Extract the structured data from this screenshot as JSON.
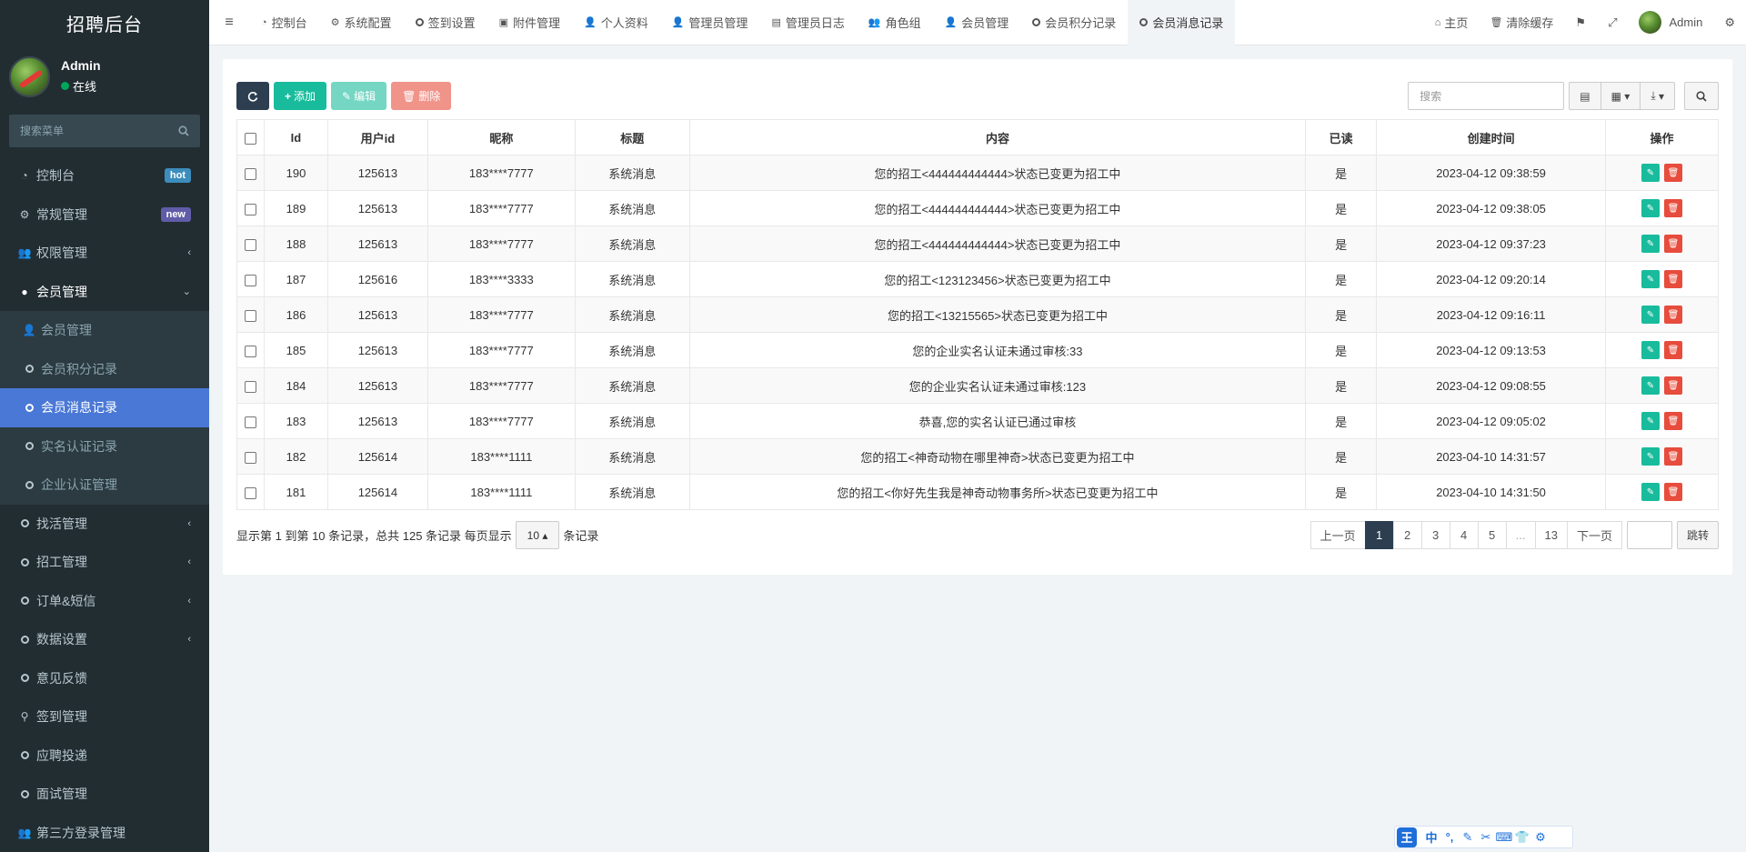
{
  "app": {
    "title": "招聘后台"
  },
  "user": {
    "name": "Admin",
    "status": "在线"
  },
  "sidebar": {
    "search_placeholder": "搜索菜单",
    "items": [
      {
        "label": "控制台",
        "badge": "hot",
        "icon": "dashboard-icon"
      },
      {
        "label": "常规管理",
        "badge": "new",
        "icon": "cogs-icon"
      },
      {
        "label": "权限管理",
        "icon": "group-icon"
      },
      {
        "label": "会员管理",
        "icon": "user-circle-icon"
      }
    ],
    "submenu": [
      {
        "label": "会员管理",
        "icon": "user-icon"
      },
      {
        "label": "会员积分记录",
        "icon": "circle-icon"
      },
      {
        "label": "会员消息记录",
        "icon": "circle-icon",
        "active": true
      },
      {
        "label": "实名认证记录",
        "icon": "circle-icon"
      },
      {
        "label": "企业认证管理",
        "icon": "circle-icon"
      }
    ],
    "items_after": [
      {
        "label": "找活管理",
        "icon": "circle-icon",
        "chevron": true
      },
      {
        "label": "招工管理",
        "icon": "circle-icon",
        "chevron": true
      },
      {
        "label": "订单&短信",
        "icon": "circle-icon",
        "chevron": true
      },
      {
        "label": "数据设置",
        "icon": "circle-icon",
        "chevron": true
      },
      {
        "label": "意见反馈",
        "icon": "circle-icon"
      },
      {
        "label": "签到管理",
        "icon": "map-marker-icon"
      },
      {
        "label": "应聘投递",
        "icon": "circle-icon"
      },
      {
        "label": "面试管理",
        "icon": "circle-icon"
      },
      {
        "label": "第三方登录管理",
        "icon": "users-icon"
      }
    ]
  },
  "topnav": {
    "tabs": [
      {
        "label": "控制台",
        "icon": "dashboard-icon"
      },
      {
        "label": "系统配置",
        "icon": "cog-icon"
      },
      {
        "label": "签到设置",
        "icon": "circle-icon"
      },
      {
        "label": "附件管理",
        "icon": "file-image-icon"
      },
      {
        "label": "个人资料",
        "icon": "user-icon"
      },
      {
        "label": "管理员管理",
        "icon": "user-icon"
      },
      {
        "label": "管理员日志",
        "icon": "list-alt-icon"
      },
      {
        "label": "角色组",
        "icon": "group-icon"
      },
      {
        "label": "会员管理",
        "icon": "user-icon"
      },
      {
        "label": "会员积分记录",
        "icon": "circle-icon"
      },
      {
        "label": "会员消息记录",
        "icon": "circle-icon",
        "active": true
      }
    ],
    "right": {
      "home": "主页",
      "clear_cache": "清除缓存",
      "admin": "Admin"
    }
  },
  "toolbar": {
    "add": "添加",
    "edit": "编辑",
    "delete": "删除",
    "search_placeholder": "搜索"
  },
  "table": {
    "headers": [
      "Id",
      "用户id",
      "昵称",
      "标题",
      "内容",
      "已读",
      "创建时间",
      "操作"
    ],
    "rows": [
      {
        "id": "190",
        "uid": "125613",
        "nick": "183****7777",
        "title": "系统消息",
        "content": "您的招工<444444444444>状态已变更为招工中",
        "read": "是",
        "time": "2023-04-12 09:38:59"
      },
      {
        "id": "189",
        "uid": "125613",
        "nick": "183****7777",
        "title": "系统消息",
        "content": "您的招工<444444444444>状态已变更为招工中",
        "read": "是",
        "time": "2023-04-12 09:38:05"
      },
      {
        "id": "188",
        "uid": "125613",
        "nick": "183****7777",
        "title": "系统消息",
        "content": "您的招工<444444444444>状态已变更为招工中",
        "read": "是",
        "time": "2023-04-12 09:37:23"
      },
      {
        "id": "187",
        "uid": "125616",
        "nick": "183****3333",
        "title": "系统消息",
        "content": "您的招工<123123456>状态已变更为招工中",
        "read": "是",
        "time": "2023-04-12 09:20:14"
      },
      {
        "id": "186",
        "uid": "125613",
        "nick": "183****7777",
        "title": "系统消息",
        "content": "您的招工<13215565>状态已变更为招工中",
        "read": "是",
        "time": "2023-04-12 09:16:11"
      },
      {
        "id": "185",
        "uid": "125613",
        "nick": "183****7777",
        "title": "系统消息",
        "content": "您的企业实名认证未通过审核:33",
        "read": "是",
        "time": "2023-04-12 09:13:53"
      },
      {
        "id": "184",
        "uid": "125613",
        "nick": "183****7777",
        "title": "系统消息",
        "content": "您的企业实名认证未通过审核:123",
        "read": "是",
        "time": "2023-04-12 09:08:55"
      },
      {
        "id": "183",
        "uid": "125613",
        "nick": "183****7777",
        "title": "系统消息",
        "content": "恭喜,您的实名认证已通过审核",
        "read": "是",
        "time": "2023-04-12 09:05:02"
      },
      {
        "id": "182",
        "uid": "125614",
        "nick": "183****1111",
        "title": "系统消息",
        "content": "您的招工<神奇动物在哪里神奇>状态已变更为招工中",
        "read": "是",
        "time": "2023-04-10 14:31:57"
      },
      {
        "id": "181",
        "uid": "125614",
        "nick": "183****1111",
        "title": "系统消息",
        "content": "您的招工<你好先生我是神奇动物事务所>状态已变更为招工中",
        "read": "是",
        "time": "2023-04-10 14:31:50"
      }
    ]
  },
  "pagination": {
    "info_prefix": "显示第 1 到第 10 条记录，总共 125 条记录 每页显示",
    "page_size": "10",
    "info_suffix": "条记录",
    "prev": "上一页",
    "pages": [
      "1",
      "2",
      "3",
      "4",
      "5",
      "...",
      "13"
    ],
    "active_page": "1",
    "next": "下一页",
    "jump": "跳转"
  },
  "ime": {
    "logo": "王",
    "mode": "中"
  },
  "colors": {
    "sidebar_bg": "#222d32",
    "active_menu": "#4a78d6",
    "primary": "#18bc9c",
    "danger": "#e74c3c",
    "dark": "#2c3e50"
  }
}
